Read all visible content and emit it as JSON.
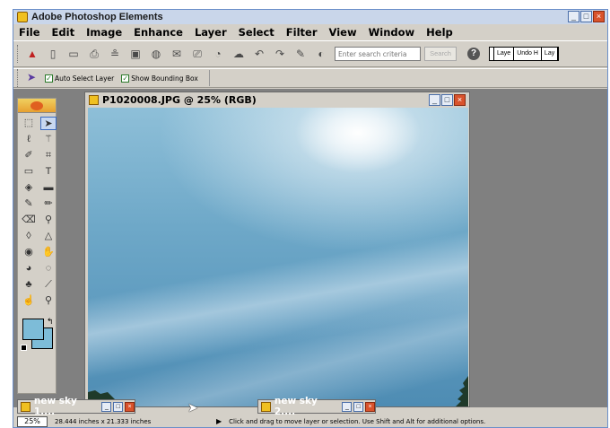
{
  "app": {
    "title": "Adobe Photoshop Elements",
    "window_buttons": [
      "_",
      "□",
      "×"
    ]
  },
  "menu": [
    "File",
    "Edit",
    "Image",
    "Enhance",
    "Layer",
    "Select",
    "Filter",
    "View",
    "Window",
    "Help"
  ],
  "toolbar": {
    "search_placeholder": "Enter search criteria",
    "search_button": "Search",
    "help": "?",
    "palette_tabs": [
      "Laye",
      "Undo H",
      "Lay"
    ]
  },
  "options": {
    "auto_select_layer": "Auto Select Layer",
    "show_bounding_box": "Show Bounding Box",
    "auto_select_checked": true,
    "show_bounding_checked": true
  },
  "document": {
    "title": "P1020008.JPG @ 25% (RGB)"
  },
  "minimized_docs": [
    {
      "title": "new sky 1...."
    },
    {
      "title": "new sky 2...."
    }
  ],
  "status": {
    "zoom": "25%",
    "dimensions": "28.444 inches x 21.333 inches",
    "hint": "Click and drag to move layer or selection. Use Shift and Alt for additional options."
  },
  "colors": {
    "foreground": "#7dbcd8",
    "background": "#7dbcd8",
    "workspace": "#808080"
  }
}
